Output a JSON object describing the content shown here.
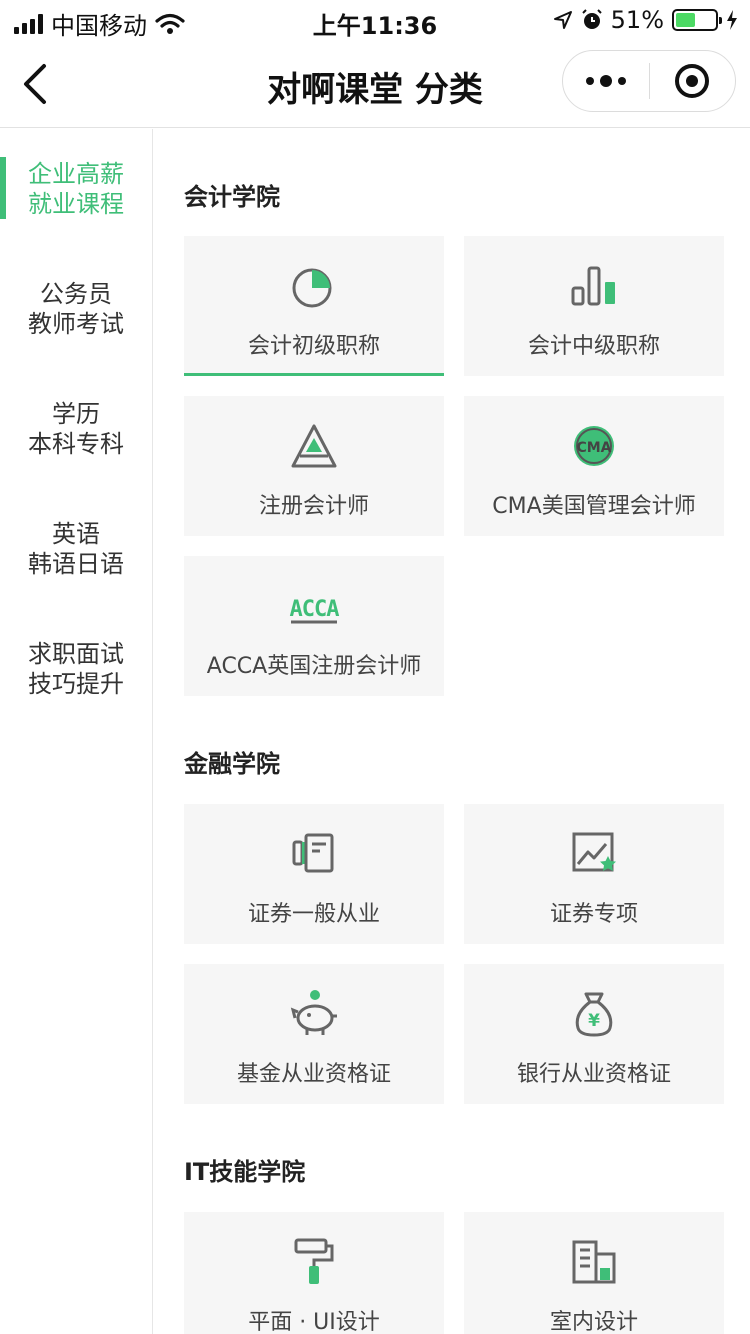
{
  "status_bar": {
    "carrier": "中国移动",
    "time": "上午11:36",
    "battery": "51%",
    "battery_level": 0.51
  },
  "nav": {
    "title": "对啊课堂 分类"
  },
  "sidebar": {
    "items": [
      {
        "line1": "企业高薪",
        "line2": "就业课程",
        "active": true
      },
      {
        "line1": "公务员",
        "line2": "教师考试"
      },
      {
        "line1": "学历",
        "line2": "本科专科"
      },
      {
        "line1": "英语",
        "line2": "韩语日语"
      },
      {
        "line1": "求职面试",
        "line2": "技巧提升"
      }
    ]
  },
  "sections": [
    {
      "title": "会计学院",
      "cards": [
        {
          "label": "会计初级职称",
          "icon": "pie-chart-icon",
          "selected": true
        },
        {
          "label": "会计中级职称",
          "icon": "bar-chart-icon"
        },
        {
          "label": "注册会计师",
          "icon": "triangle-icon"
        },
        {
          "label": "CMA美国管理会计师",
          "icon": "cma-badge-icon",
          "badge": "CMA"
        },
        {
          "label": "ACCA英国注册会计师",
          "icon": "acca-logo-icon",
          "badge": "ACCA"
        }
      ]
    },
    {
      "title": "金融学院",
      "cards": [
        {
          "label": "证券一般从业",
          "icon": "document-icon"
        },
        {
          "label": "证券专项",
          "icon": "trend-chart-icon"
        },
        {
          "label": "基金从业资格证",
          "icon": "piggy-bank-icon"
        },
        {
          "label": "银行从业资格证",
          "icon": "money-bag-icon",
          "badge": "¥"
        }
      ]
    },
    {
      "title": "IT技能学院",
      "cards": [
        {
          "label": "平面 · UI设计",
          "icon": "paint-roller-icon"
        },
        {
          "label": "室内设计",
          "icon": "building-icon"
        }
      ]
    }
  ],
  "colors": {
    "accent": "#3fbe78",
    "card_bg": "#f6f6f6",
    "icon_gray": "#666666"
  }
}
